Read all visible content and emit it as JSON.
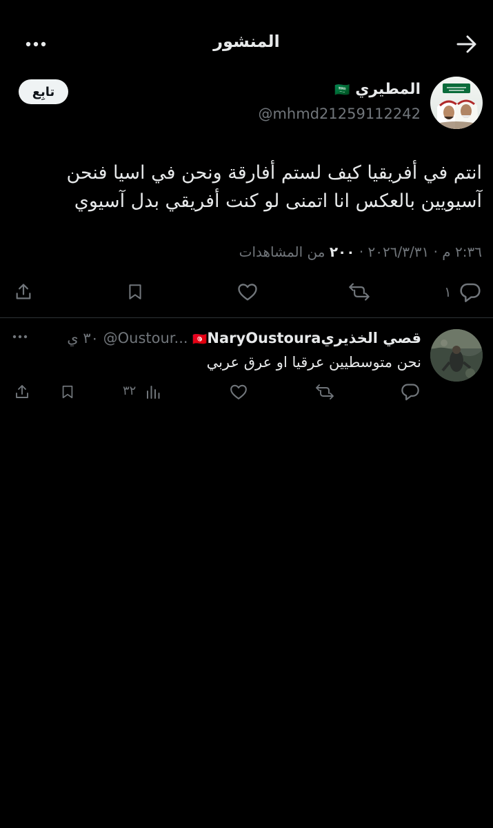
{
  "header": {
    "title": "المنشور"
  },
  "post": {
    "display_name": "المطيري",
    "flag": "🇸🇦",
    "handle": "@mhmd21259112242",
    "follow_label": "تابِع",
    "text_line1": "انتم في أفريقيا كيف لستم أفارقة ونحن في اسيا فنحن",
    "text_line2": "آسيويين بالعكس انا اتمنى لو كنت أفريقي بدل آسيوي",
    "meta_datetime": "٢:٣٦ م · ٢٠٢٦/٣/٣١ · ",
    "meta_views_count": "٢٠٠",
    "meta_views_label": " من المشاهدات",
    "reply_count": "١"
  },
  "reply": {
    "display_name": "قصي الخذيري",
    "flag": "🇹🇳",
    "username_part": "NaryOustoura",
    "handle": "@Oustour...",
    "time": "٣٠ ي",
    "text": "نحن متوسطيين عرقيا او عرق عربي",
    "view_count": "٣٢"
  },
  "icons": {
    "back": "arrow-right-icon",
    "more": "more-horizontal-icon",
    "reply": "speech-bubble-icon",
    "repost": "repost-icon",
    "like": "heart-icon",
    "bookmark": "bookmark-icon",
    "share": "share-icon",
    "views": "bar-chart-icon"
  }
}
